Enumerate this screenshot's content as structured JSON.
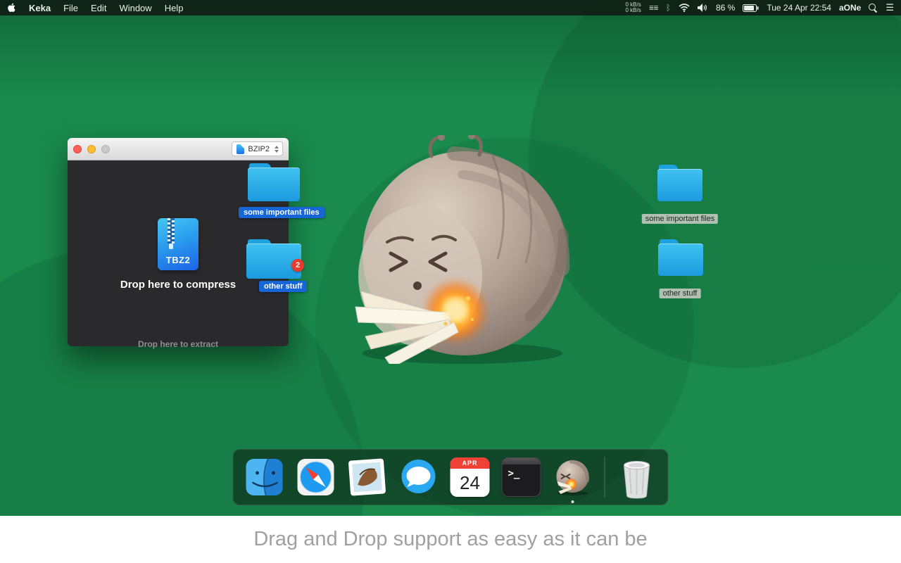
{
  "menu_bar": {
    "app_name": "Keka",
    "menus": [
      "File",
      "Edit",
      "Window",
      "Help"
    ],
    "status": {
      "net_up": "0 kB/s",
      "net_down": "0 kB/s",
      "net_graph_glyph": "≣≣",
      "bluetooth_glyph": "ᛒ",
      "battery_percent": "86 %",
      "clock": "Tue 24 Apr  22:54",
      "user": "aONe",
      "list_glyph": "☰"
    }
  },
  "window": {
    "format_select": "BZIP2",
    "archive_type": "TBZ2",
    "compress_label": "Drop here to compress",
    "extract_label": "Drop here to extract"
  },
  "drag_items": [
    {
      "label": "some important files"
    },
    {
      "label": "other stuff",
      "badge": "2"
    }
  ],
  "desktop_items": [
    {
      "label": "some important files"
    },
    {
      "label": "other stuff"
    }
  ],
  "dock": {
    "items": [
      "finder",
      "safari",
      "mail",
      "messages",
      "calendar",
      "terminal",
      "keka",
      "trash"
    ],
    "calendar_month": "APR",
    "calendar_day": "24",
    "terminal_glyph": ">_"
  },
  "caption": "Drag and Drop support as easy as it can be",
  "colors": {
    "desktop_green": "#1a8a4d",
    "folder_cyan": "#2eb6ec",
    "label_blue": "#1766d8",
    "badge_red": "#e8392c",
    "window_dark": "#2a2a2c"
  }
}
